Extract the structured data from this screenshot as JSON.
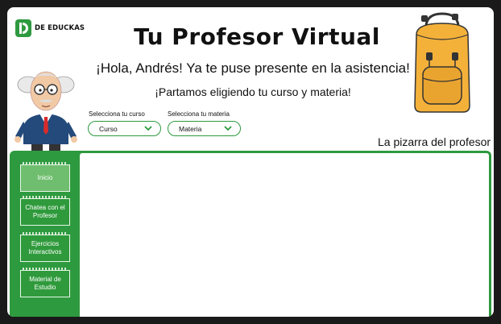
{
  "brand": {
    "name": "DE EDUCKAS"
  },
  "header": {
    "title": "Tu Profesor Virtual",
    "greeting": "¡Hola, Andrés! Ya te puse presente en la asistencia!",
    "subtitle": "¡Partamos eligiendo tu curso y materia!"
  },
  "filters": {
    "course": {
      "label": "Selecciona tu curso",
      "value": "Curso"
    },
    "subject": {
      "label": "Selecciona tu materia",
      "value": "Materia"
    }
  },
  "board": {
    "title": "La pizarra del profesor"
  },
  "menu": {
    "items": [
      {
        "label": "Inicio"
      },
      {
        "label": "Chatea con el Profesor"
      },
      {
        "label": "Ejercicios Interactivos"
      },
      {
        "label": "Material de Estudio"
      }
    ]
  },
  "colors": {
    "accent": "#2e9a3f",
    "active": "#6fbe6f",
    "backpack": "#f4b13a"
  },
  "icons": [
    "logo-icon",
    "chevron-down-icon",
    "professor-illustration",
    "backpack-illustration"
  ]
}
